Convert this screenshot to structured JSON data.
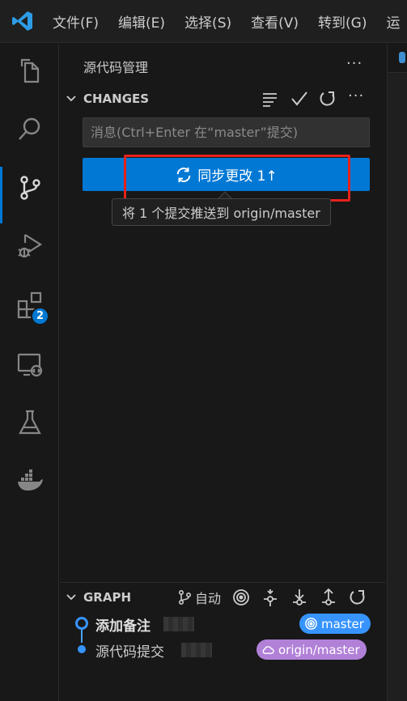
{
  "menu": [
    "文件(F)",
    "编辑(E)",
    "选择(S)",
    "查看(V)",
    "转到(G)",
    "运"
  ],
  "activity": {
    "extensions_badge": "2"
  },
  "sidebar": {
    "title": "源代码管理",
    "more": "···"
  },
  "changes": {
    "label": "CHANGES",
    "more": "···",
    "message_placeholder": "消息(Ctrl+Enter 在“master”提交)",
    "sync_button_label": "同步更改 1↑",
    "tooltip": "将 1 个提交推送到 origin/master"
  },
  "graph": {
    "label": "GRAPH",
    "auto_label": "自动",
    "commits": [
      {
        "message": "添加备注",
        "ref": "master"
      },
      {
        "message": "源代码提交",
        "ref": "origin/master"
      }
    ]
  },
  "colors": {
    "accent": "#0078d4",
    "highlight": "#e8211b",
    "ref_local": "#3794ff",
    "ref_remote": "#b180d7"
  }
}
